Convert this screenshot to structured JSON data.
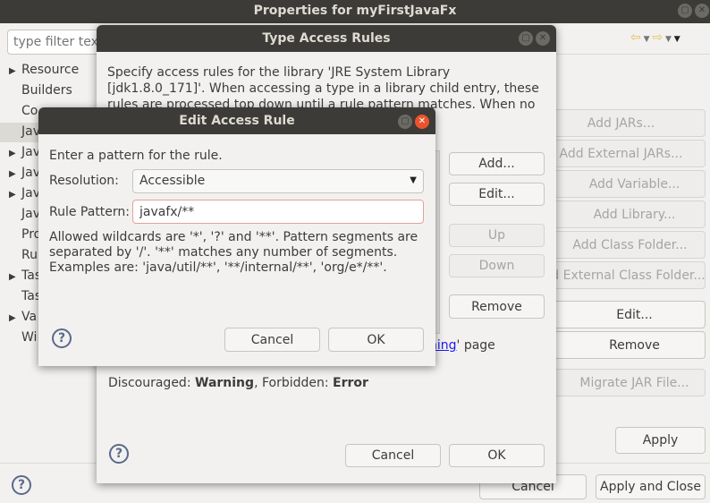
{
  "main": {
    "title": "Properties for myFirstJavaFx",
    "filter_placeholder": "type filter text",
    "tree": [
      {
        "label": "Resource",
        "exp": true
      },
      {
        "label": "Builders",
        "exp": false
      },
      {
        "label": "Co",
        "exp": false
      },
      {
        "label": "Jav",
        "exp": false,
        "selected": true
      },
      {
        "label": "Jav",
        "exp": true
      },
      {
        "label": "Jav",
        "exp": true
      },
      {
        "label": "Jav",
        "exp": true
      },
      {
        "label": "Jav",
        "exp": false
      },
      {
        "label": "Pro",
        "exp": false
      },
      {
        "label": "Ru",
        "exp": false
      },
      {
        "label": "Tas",
        "exp": true
      },
      {
        "label": "Tas",
        "exp": false
      },
      {
        "label": "Va",
        "exp": true
      },
      {
        "label": "Wi",
        "exp": false
      }
    ],
    "right_buttons": {
      "add_jars": "Add JARs...",
      "add_external_jars": "Add External JARs...",
      "add_variable": "Add Variable...",
      "add_library": "Add Library...",
      "add_class_folder": "Add Class Folder...",
      "add_external_class_folder": "d External Class Folder...",
      "edit": "Edit...",
      "remove": "Remove",
      "migrate": "Migrate JAR File..."
    },
    "apply": "Apply",
    "cancel": "Cancel",
    "apply_close": "Apply and Close",
    "help": "?"
  },
  "type_rules": {
    "title": "Type Access Rules",
    "description": "Specify access rules for the library 'JRE System Library [jdk1.8.0_171]'. When accessing a type in a library child entry, these rules are processed top down until a rule pattern matches. When no pattern matches, the",
    "buttons": {
      "add": "Add...",
      "edit": "Edit...",
      "up": "Up",
      "down": "Down",
      "remove": "Remove"
    },
    "link_text": "ning",
    "page_text": "' page",
    "discouraged_label": "Discouraged: ",
    "discouraged_value": "Warning",
    "forbidden_label": ", Forbidden: ",
    "forbidden_value": "Error",
    "cancel": "Cancel",
    "ok": "OK",
    "help": "?"
  },
  "edit_rule": {
    "title": "Edit Access Rule",
    "prompt": "Enter a pattern for the rule.",
    "resolution_label": "Resolution:",
    "resolution_value": "Accessible",
    "pattern_label": "Rule Pattern:",
    "pattern_value": "javafx/**",
    "hint": "Allowed wildcards are '*', '?' and '**'. Pattern segments are separated by '/'. '**' matches any number of segments. Examples are: 'java/util/**', '**/internal/**', 'org/e*/**'.",
    "cancel": "Cancel",
    "ok": "OK",
    "help": "?"
  }
}
